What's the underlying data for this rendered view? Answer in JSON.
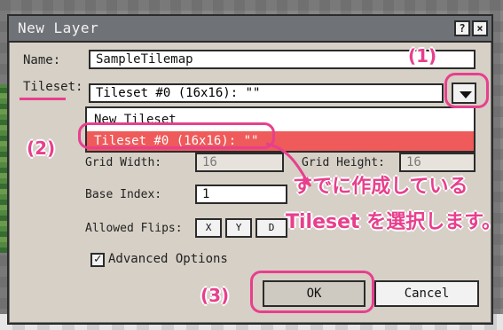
{
  "dialog": {
    "title": "New Layer",
    "help_icon": "help-icon",
    "close_icon": "close-icon",
    "name_label": "Name:",
    "name_value": "SampleTilemap",
    "tileset_label": "Tileset:",
    "tileset_value": "Tileset #0 (16x16): \"\"",
    "tileset_options": [
      "New Tileset",
      "Tileset #0 (16x16): \"\""
    ],
    "grid_width_label": "Grid Width:",
    "grid_width_value": "16",
    "grid_height_label": "Grid Height:",
    "grid_height_value": "16",
    "base_index_label": "Base Index:",
    "base_index_value": "1",
    "allowed_flips_label": "Allowed Flips:",
    "flips": [
      "X",
      "Y",
      "D"
    ],
    "advanced_options_label": "Advanced Options",
    "ok_label": "OK",
    "cancel_label": "Cancel"
  },
  "annotations": {
    "step1": "(1)",
    "step2": "(2)",
    "step3": "(3)",
    "note_line1": "すでに作成している",
    "note_line2": "Tileset を選択します。",
    "accent_color": "#e83f8d"
  }
}
